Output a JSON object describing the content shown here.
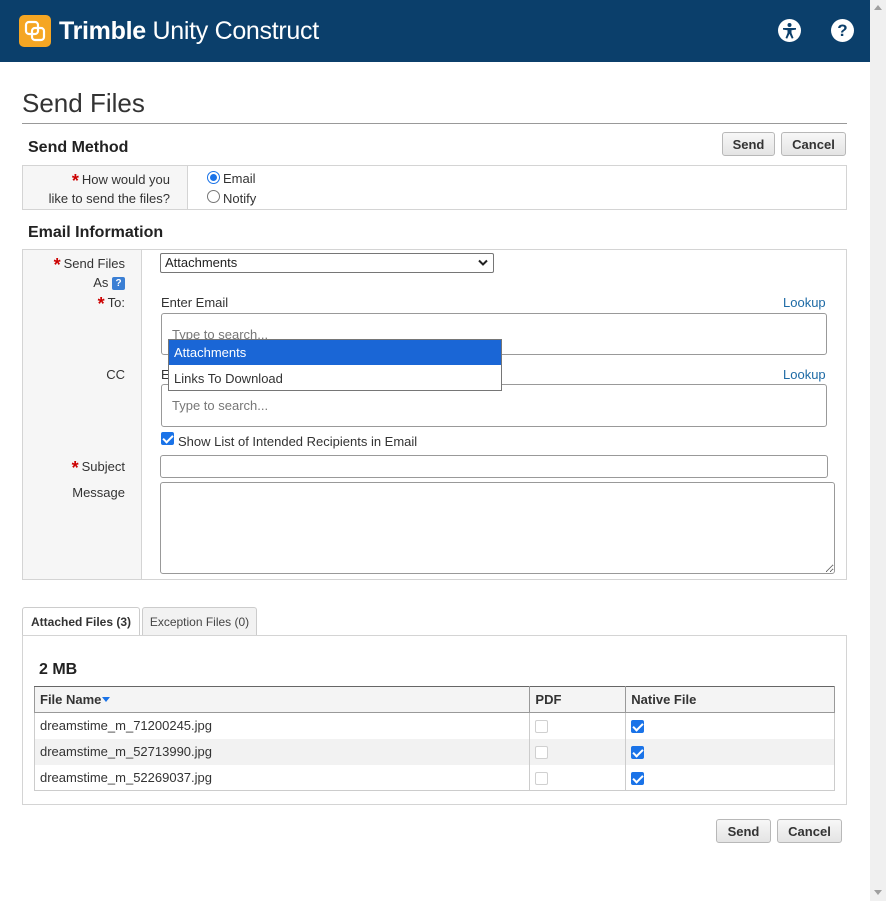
{
  "header": {
    "brand_bold": "Trimble",
    "brand_light": " Unity Construct",
    "accessibility_icon": "accessibility-icon",
    "help_icon": "help-icon",
    "help_glyph": "?",
    "logo_color": "#f5a623",
    "bar_color": "#0b3f6b"
  },
  "page": {
    "title": "Send Files"
  },
  "toolbar": {
    "send_label": "Send",
    "cancel_label": "Cancel"
  },
  "send_method": {
    "title": "Send Method",
    "question_line1": "How would you",
    "question_line2": "like to send the files?",
    "options": [
      "Email",
      "Notify"
    ],
    "selected": "Email"
  },
  "email_info": {
    "title": "Email Information",
    "send_files_as_label_1": "Send Files",
    "send_files_as_label_2": "As",
    "send_files_as_value": "Attachments",
    "dropdown_options": [
      "Attachments",
      "Links To Download"
    ],
    "to_label": "To:",
    "to_field_label": "Enter Email",
    "lookup_label": "Lookup",
    "search_placeholder": "Type to search...",
    "cc_label": "CC",
    "cc_field_label_visible": "E",
    "show_recipients_label": "Show List of Intended Recipients in Email",
    "show_recipients_checked": true,
    "subject_label": "Subject",
    "message_label": "Message"
  },
  "tabs": [
    {
      "label": "Attached Files (3)",
      "active": true
    },
    {
      "label": "Exception Files (0)",
      "active": false
    }
  ],
  "files": {
    "total_size": "2 MB",
    "columns": [
      "File Name",
      "PDF",
      "Native File"
    ],
    "rows": [
      {
        "name": "dreamstime_m_71200245.jpg",
        "pdf": false,
        "native": true
      },
      {
        "name": "dreamstime_m_52713990.jpg",
        "pdf": false,
        "native": true
      },
      {
        "name": "dreamstime_m_52269037.jpg",
        "pdf": false,
        "native": true
      }
    ]
  },
  "footer": {
    "send_label": "Send",
    "cancel_label": "Cancel"
  }
}
